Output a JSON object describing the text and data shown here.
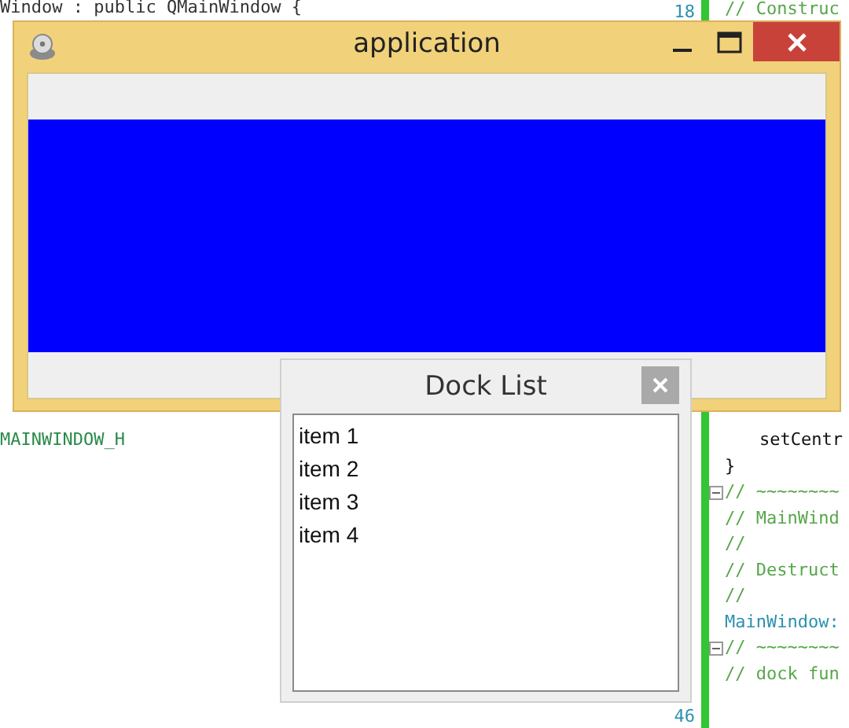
{
  "editor_left": {
    "top_line": "Window : public QMainWindow {",
    "bottom_line": "MAINWINDOW_H"
  },
  "editor_right": {
    "line_numbers": [
      "18",
      "46"
    ],
    "top_line": "// Construc",
    "lines": [
      {
        "text": "setCentr",
        "kind": "code",
        "indented": true,
        "fold": false
      },
      {
        "text": "}",
        "kind": "code",
        "indented": false,
        "fold": false
      },
      {
        "text": "// ~~~~~~~~",
        "kind": "comment",
        "indented": false,
        "fold": true
      },
      {
        "text": "// MainWind",
        "kind": "comment",
        "indented": false,
        "fold": false
      },
      {
        "text": "//",
        "kind": "comment",
        "indented": false,
        "fold": false
      },
      {
        "text": "// Destruct",
        "kind": "comment",
        "indented": false,
        "fold": false
      },
      {
        "text": "//",
        "kind": "comment",
        "indented": false,
        "fold": false
      },
      {
        "text": "MainWindow:",
        "kind": "type",
        "indented": false,
        "fold": false
      },
      {
        "text": "// ~~~~~~~~",
        "kind": "comment",
        "indented": false,
        "fold": true
      },
      {
        "text": "// dock fun",
        "kind": "comment",
        "indented": false,
        "fold": false
      }
    ]
  },
  "window": {
    "title": "application"
  },
  "dock": {
    "title": "Dock List",
    "items": [
      "item 1",
      "item 2",
      "item 3",
      "item 4"
    ]
  }
}
